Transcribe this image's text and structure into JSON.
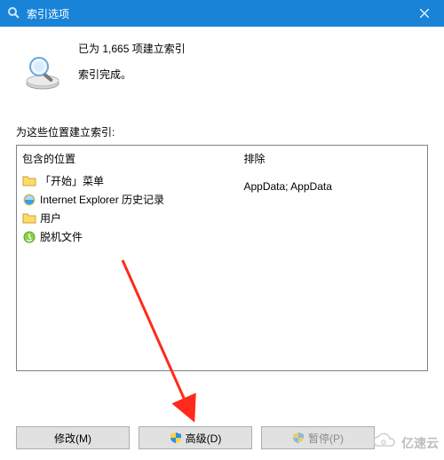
{
  "titlebar": {
    "title": "索引选项"
  },
  "status": {
    "line1": "已为 1,665 项建立索引",
    "line2": "索引完成。"
  },
  "section_label": "为这些位置建立索引:",
  "columns": {
    "included_header": "包含的位置",
    "excluded_header": "排除"
  },
  "included": [
    {
      "icon": "folder-icon",
      "label": "「开始」菜单"
    },
    {
      "icon": "ie-icon",
      "label": "Internet Explorer 历史记录"
    },
    {
      "icon": "folder-icon",
      "label": "用户"
    },
    {
      "icon": "offline-files-icon",
      "label": "脱机文件"
    }
  ],
  "excluded": [
    "",
    "",
    "AppData; AppData",
    ""
  ],
  "buttons": {
    "modify": "修改(M)",
    "advanced": "高级(D)",
    "pause": "暂停(P)"
  },
  "watermark": "亿速云"
}
